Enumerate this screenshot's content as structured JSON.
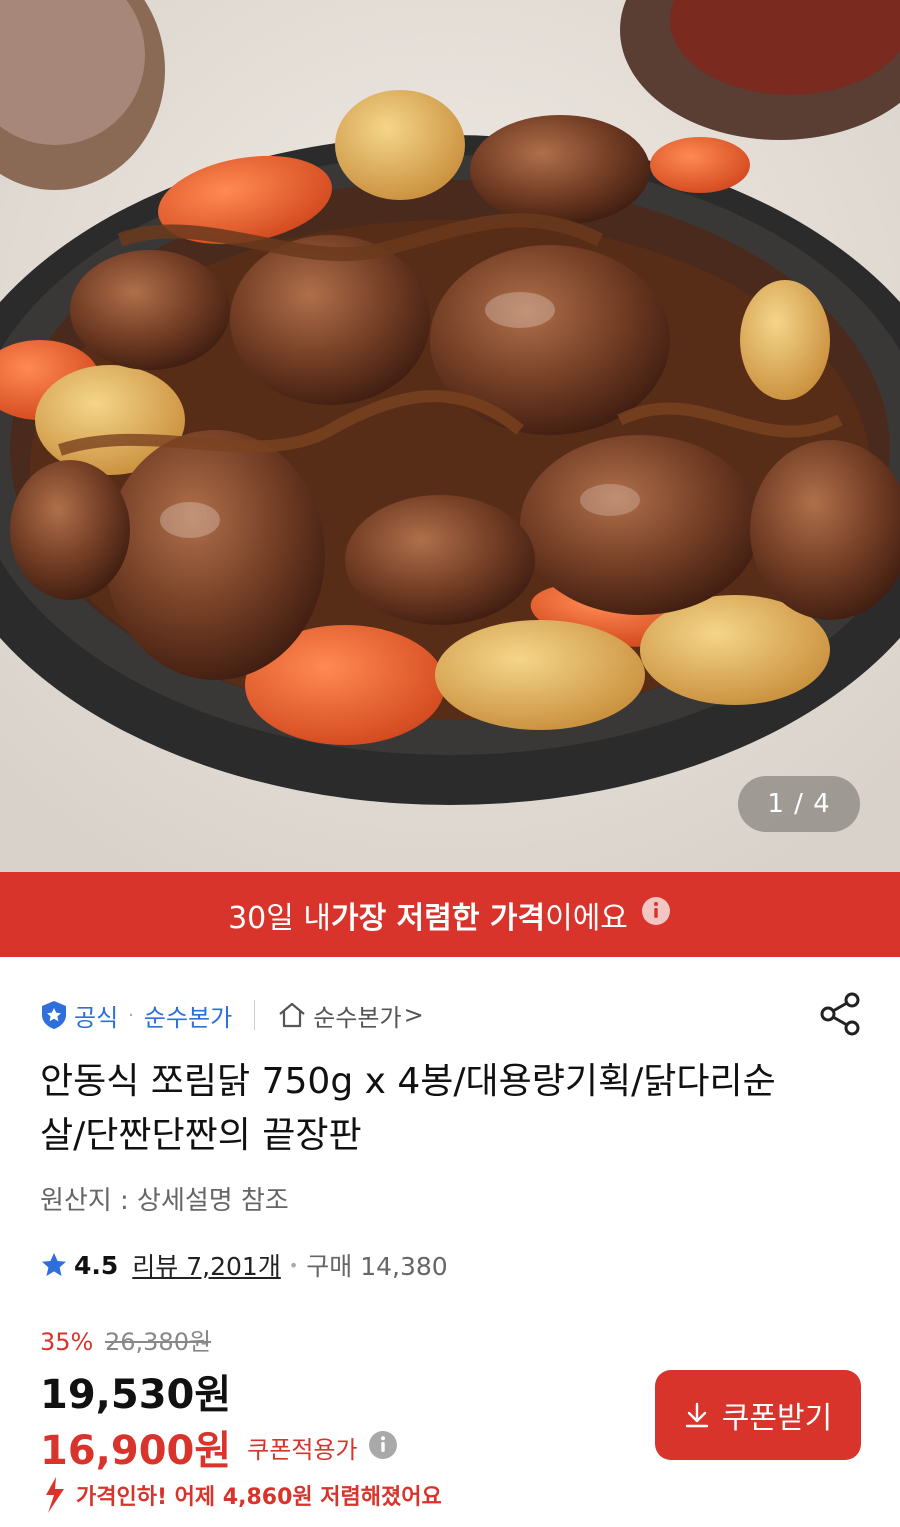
{
  "gallery": {
    "counter": "1 / 4",
    "image_alt": "Andong-style braised chicken (jjorimdak) with potatoes, carrots and glass noodles on a black stone plate"
  },
  "banner": {
    "text_pre": "30일 내 ",
    "text_bold": "가장 저렴한 가격",
    "text_post": "이에요",
    "icon": "info-icon"
  },
  "seller": {
    "official_label": "공식",
    "brand": "순수본가",
    "store_label": "순수본가",
    "store_chevron": ">",
    "share_icon": "share-icon"
  },
  "product": {
    "title": "안동식 쪼림닭 750g x 4봉/대용량기획/닭다리순살/단짠단짠의 끝장판",
    "origin": "원산지 : 상세설명 참조"
  },
  "rating": {
    "score": "4.5",
    "reviews": "리뷰 7,201개",
    "purchases": "구매 14,380"
  },
  "pricing": {
    "discount_pct": "35%",
    "original_price": "26,380원",
    "price": "19,530원",
    "coupon_price": "16,900원",
    "coupon_price_label": "쿠폰적용가",
    "coupon_button": "쿠폰받기",
    "price_drop_note": "가격인하! 어제 4,860원 저렴해졌어요"
  },
  "colors": {
    "accent_red": "#d8342c",
    "official_blue": "#2f6fdb"
  }
}
